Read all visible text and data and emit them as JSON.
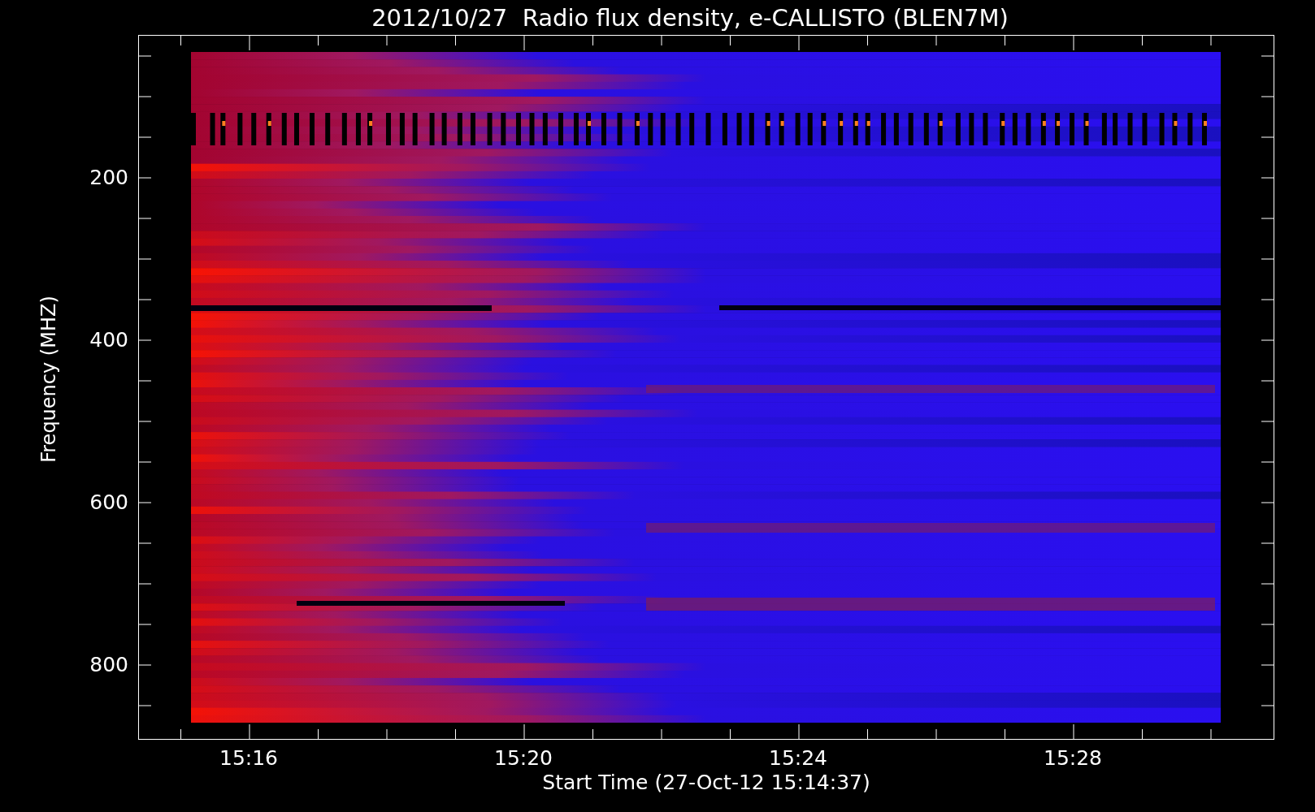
{
  "title": "2012/10/27  Radio flux density, e-CALLISTO (BLEN7M)",
  "y_axis": {
    "label": "Frequency (MHZ)",
    "ticks": [
      "200",
      "400",
      "600",
      "800"
    ]
  },
  "x_axis": {
    "label": "Start Time (27-Oct-12 15:14:37)",
    "ticks": [
      "15:16",
      "15:20",
      "15:24",
      "15:28"
    ]
  }
}
